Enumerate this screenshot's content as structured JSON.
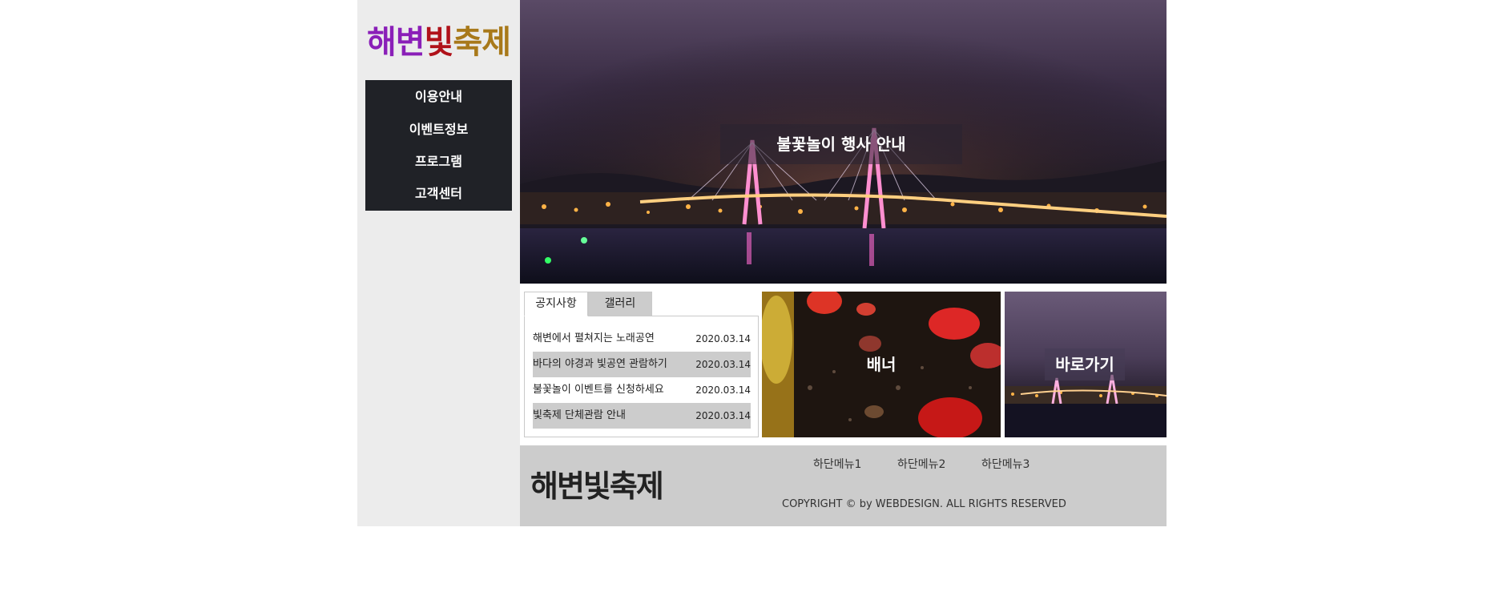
{
  "logo": {
    "parts": [
      {
        "text": "해변",
        "color": "#8a1fb8"
      },
      {
        "text": "빛",
        "color": "#b0121a"
      },
      {
        "text": "축제",
        "color": "#a8791a"
      }
    ]
  },
  "nav": {
    "items": [
      "이용안내",
      "이벤트정보",
      "프로그램",
      "고객센터"
    ]
  },
  "hero": {
    "title": "불꽃놀이 행사 안내"
  },
  "tabs": {
    "notice_label": "공지사항",
    "gallery_label": "갤러리",
    "notices": [
      {
        "title": "해변에서 펼쳐지는 노래공연",
        "date": "2020.03.14"
      },
      {
        "title": "바다의 야경과 빛공연 관람하기",
        "date": "2020.03.14"
      },
      {
        "title": "불꽃놀이 이벤트를 신청하세요",
        "date": "2020.03.14"
      },
      {
        "title": "빛축제 단체관람 안내",
        "date": "2020.03.14"
      }
    ]
  },
  "banner": {
    "label": "배너"
  },
  "shortcut": {
    "label": "바로가기"
  },
  "footer": {
    "logo": "해변빛축제",
    "menus": [
      "하단메뉴1",
      "하단메뉴2",
      "하단메뉴3"
    ],
    "copyright": "COPYRIGHT © by WEBDESIGN. ALL RIGHTS RESERVED"
  }
}
